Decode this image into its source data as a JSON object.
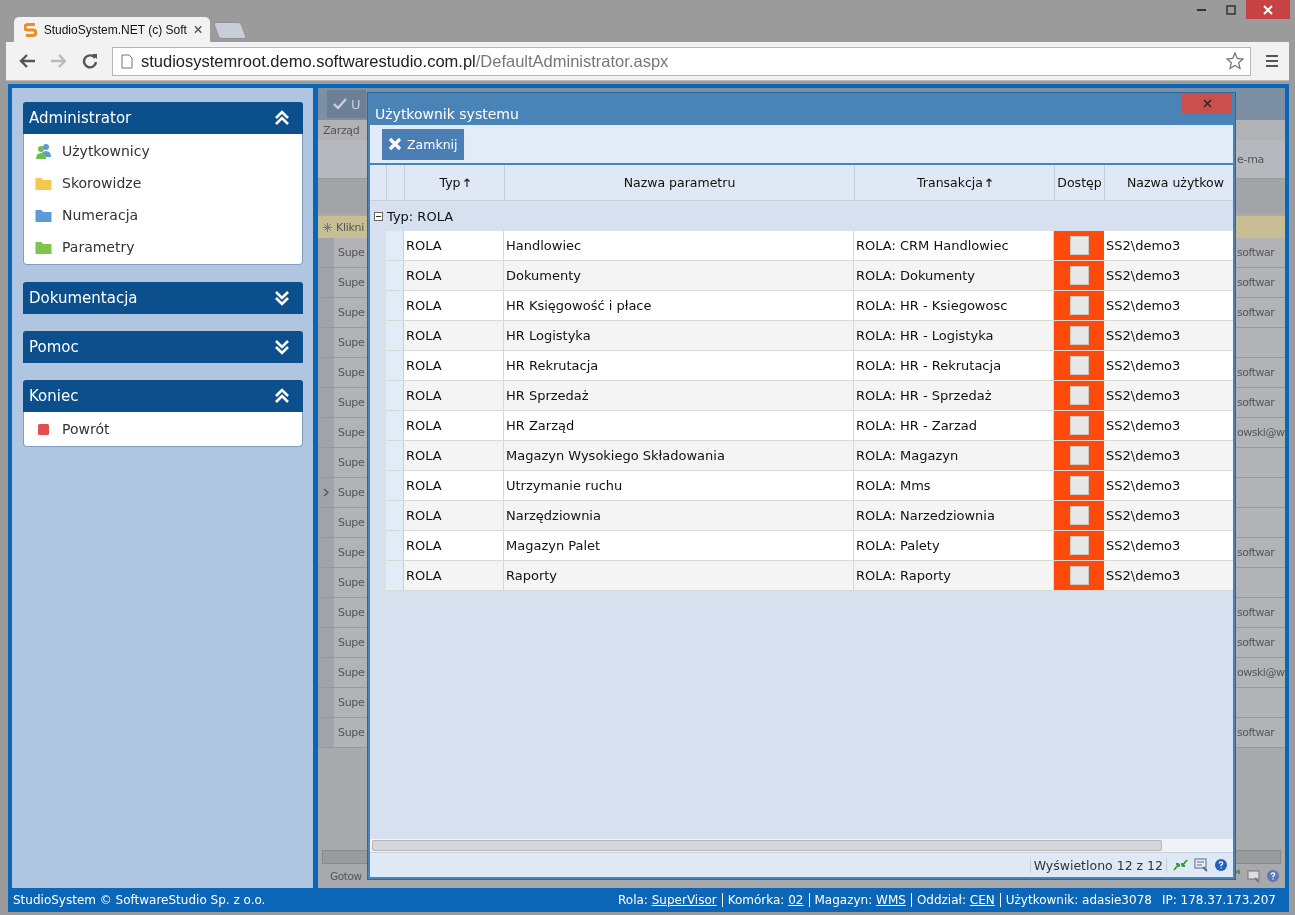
{
  "browser": {
    "tab_title": "StudioSystem.NET (c) Soft",
    "url_host": "studiosystemroot.demo.softwarestudio.com.pl",
    "url_path": "/DefaultAdministrator.aspx"
  },
  "sidebar": {
    "panels": [
      {
        "title": "Administrator",
        "expanded": true,
        "items": [
          {
            "label": "Użytkownicy",
            "kind": "users"
          },
          {
            "label": "Skorowidze",
            "kind": "folder",
            "color": "#f2c94c"
          },
          {
            "label": "Numeracja",
            "kind": "folder",
            "color": "#5b9bd5"
          },
          {
            "label": "Parametry",
            "kind": "folder",
            "color": "#7cc44a"
          }
        ]
      },
      {
        "title": "Dokumentacja",
        "expanded": false
      },
      {
        "title": "Pomoc",
        "expanded": false
      },
      {
        "title": "Koniec",
        "expanded": true,
        "items": [
          {
            "label": "Powrót",
            "kind": "square",
            "color": "#e05050"
          }
        ]
      }
    ]
  },
  "background_grid": {
    "toolbar_button": "U",
    "caption": "Zarząd",
    "header_column": "e-ma",
    "new_row_hint": "Klikni",
    "status": "Gotow",
    "rows": [
      {
        "column_1": "Supe",
        "column_2": "softwar",
        "current": false
      },
      {
        "column_1": "Supe",
        "column_2": "softwar",
        "current": false
      },
      {
        "column_1": "Supe",
        "column_2": "softwar",
        "current": false
      },
      {
        "column_1": "Supe",
        "current": false
      },
      {
        "column_1": "Supe",
        "column_2": "softwar",
        "current": false
      },
      {
        "column_1": "Supe",
        "column_2": "softwar",
        "current": false
      },
      {
        "column_1": "Supe",
        "column_2": "owski@w",
        "current": false
      },
      {
        "column_1": "Supe",
        "current": false
      },
      {
        "column_1": "Supe",
        "current": true
      },
      {
        "column_1": "Supe",
        "current": false
      },
      {
        "column_1": "Supe",
        "column_2": "softwar",
        "current": false
      },
      {
        "column_1": "Supe",
        "current": false
      },
      {
        "column_1": "Supe",
        "column_2": "softwar",
        "current": false
      },
      {
        "column_1": "Supe",
        "column_2": "softwar",
        "current": false
      },
      {
        "column_1": "Supe",
        "column_2": "owski@w",
        "current": false
      },
      {
        "column_1": "Supe",
        "current": false
      },
      {
        "column_1": "Supe",
        "column_2": "softwar",
        "current": false
      }
    ]
  },
  "dialog": {
    "title": "Użytkownik systemu",
    "close_button": "Zamknij",
    "columns": [
      {
        "label": "Typ",
        "sorted": true
      },
      {
        "label": "Nazwa parametru",
        "sorted": false
      },
      {
        "label": "Transakcja",
        "sorted": true
      },
      {
        "label": "Dostęp",
        "sorted": false
      },
      {
        "label": "Nazwa użytkow",
        "sorted": false
      }
    ],
    "group": {
      "label": "Typ: ROLA",
      "expanded": true,
      "rows": [
        {
          "typ": "ROLA",
          "name": "Handlowiec",
          "transaction": "ROLA: CRM Handlowiec",
          "access": false,
          "user": "SS2\\demo3"
        },
        {
          "typ": "ROLA",
          "name": "Dokumenty",
          "transaction": "ROLA: Dokumenty",
          "access": false,
          "user": "SS2\\demo3"
        },
        {
          "typ": "ROLA",
          "name": "HR Księgowość i płace",
          "transaction": "ROLA: HR - Ksiegowosc",
          "access": false,
          "user": "SS2\\demo3"
        },
        {
          "typ": "ROLA",
          "name": "HR Logistyka",
          "transaction": "ROLA: HR - Logistyka",
          "access": false,
          "user": "SS2\\demo3"
        },
        {
          "typ": "ROLA",
          "name": "HR Rekrutacja",
          "transaction": "ROLA: HR - Rekrutacja",
          "access": false,
          "user": "SS2\\demo3"
        },
        {
          "typ": "ROLA",
          "name": "HR Sprzedaż",
          "transaction": "ROLA: HR - Sprzedaż",
          "access": false,
          "user": "SS2\\demo3"
        },
        {
          "typ": "ROLA",
          "name": "HR Zarząd",
          "transaction": "ROLA: HR - Zarzad",
          "access": false,
          "user": "SS2\\demo3"
        },
        {
          "typ": "ROLA",
          "name": "Magazyn Wysokiego Składowania",
          "transaction": "ROLA: Magazyn",
          "access": false,
          "user": "SS2\\demo3"
        },
        {
          "typ": "ROLA",
          "name": "Utrzymanie ruchu",
          "transaction": "ROLA: Mms",
          "access": false,
          "user": "SS2\\demo3"
        },
        {
          "typ": "ROLA",
          "name": "Narzędziownia",
          "transaction": "ROLA: Narzedziownia",
          "access": false,
          "user": "SS2\\demo3"
        },
        {
          "typ": "ROLA",
          "name": "Magazyn Palet",
          "transaction": "ROLA: Palety",
          "access": false,
          "user": "SS2\\demo3"
        },
        {
          "typ": "ROLA",
          "name": "Raporty",
          "transaction": "ROLA: Raporty",
          "access": false,
          "user": "SS2\\demo3"
        }
      ]
    },
    "status": "Wyświetlono 12 z 12"
  },
  "footer": {
    "copyright": "StudioSystem © SoftwareStudio Sp. z o.o.",
    "fields": [
      {
        "label": "Rola:",
        "value": "SuperVisor",
        "link": true,
        "separator_after": true
      },
      {
        "label": "Komórka:",
        "value": "02",
        "link": true,
        "separator_after": true
      },
      {
        "label": "Magazyn:",
        "value": "WMS",
        "link": true,
        "separator_after": true
      },
      {
        "label": "Oddział:",
        "value": "CEN",
        "link": true,
        "separator_after": true
      },
      {
        "label": "Użytkownik:",
        "value": "adasie3078",
        "link": false,
        "separator_after": false
      },
      {
        "label": "IP:",
        "value": "178.37.173.207",
        "link": false,
        "separator_after": false
      }
    ]
  }
}
